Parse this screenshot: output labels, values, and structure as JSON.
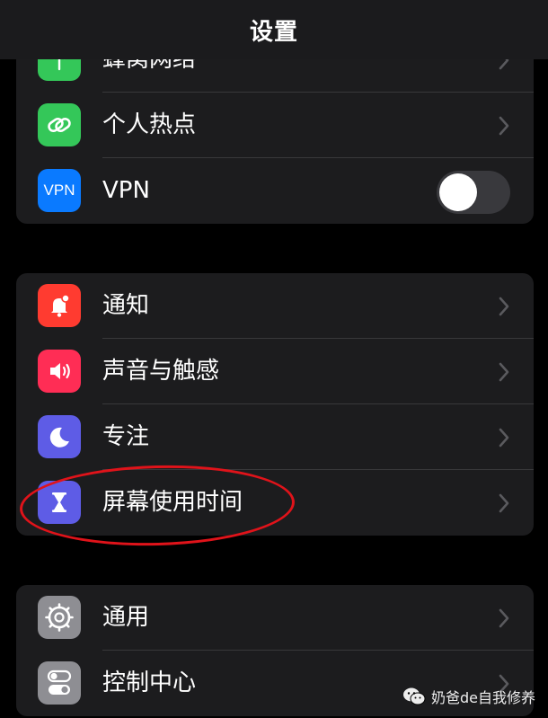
{
  "nav": {
    "title": "设置"
  },
  "group1": {
    "items": [
      {
        "label": "蜂窝网络",
        "icon": "antenna-icon",
        "color": "#34c759",
        "control": "chevron"
      },
      {
        "label": "个人热点",
        "icon": "hotspot-chain-icon",
        "color": "#34c759",
        "control": "chevron"
      },
      {
        "label": "VPN",
        "icon": "vpn-icon",
        "icon_text": "VPN",
        "color": "#0a7aff",
        "control": "toggle",
        "toggle_on": false
      }
    ]
  },
  "group2": {
    "items": [
      {
        "label": "通知",
        "icon": "bell-icon",
        "color": "#ff3b30",
        "control": "chevron"
      },
      {
        "label": "声音与触感",
        "icon": "speaker-icon",
        "color": "#ff2d55",
        "control": "chevron"
      },
      {
        "label": "专注",
        "icon": "moon-icon",
        "color": "#5e5ce6",
        "control": "chevron"
      },
      {
        "label": "屏幕使用时间",
        "icon": "hourglass-icon",
        "color": "#5e5ce6",
        "control": "chevron",
        "highlighted": true
      }
    ]
  },
  "group3": {
    "items": [
      {
        "label": "通用",
        "icon": "gear-icon",
        "color": "#8e8e93",
        "control": "chevron"
      },
      {
        "label": "控制中心",
        "icon": "switches-icon",
        "color": "#8e8e93",
        "control": "chevron"
      }
    ]
  },
  "watermark": {
    "text": "奶爸de自我修养",
    "icon": "wechat-icon"
  },
  "colors": {
    "background": "#000000",
    "group_background": "#1c1c1e",
    "separator": "#38383a",
    "chevron": "#5a5a5e",
    "highlight_circle": "#e0131a"
  }
}
